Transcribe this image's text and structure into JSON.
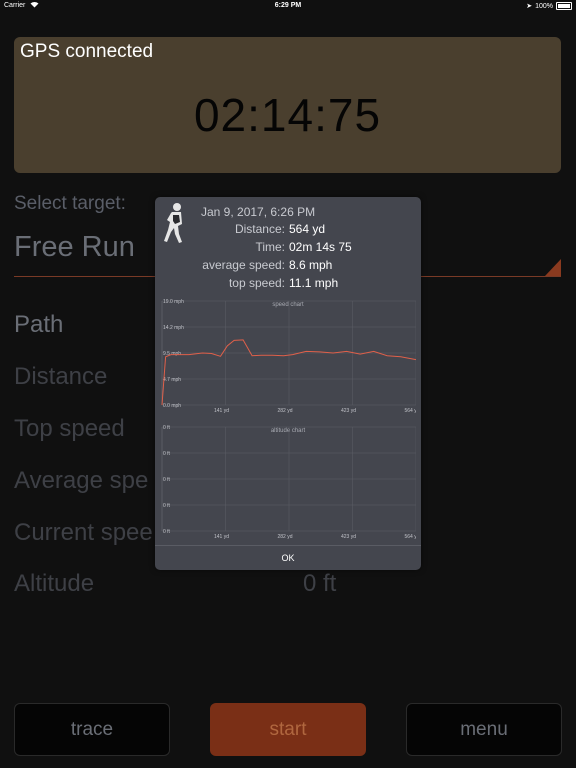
{
  "status_bar": {
    "carrier": "Carrier",
    "time": "6:29 PM",
    "battery": "100%"
  },
  "timer": {
    "gps_status": "GPS connected",
    "elapsed": "02:14:75"
  },
  "target": {
    "label": "Select target:",
    "value": "Free Run"
  },
  "stats": [
    {
      "label": "Path"
    },
    {
      "label": "Distance"
    },
    {
      "label": "Top speed"
    },
    {
      "label": "Average spe"
    },
    {
      "label": "Current spee"
    },
    {
      "label": "Altitude",
      "value": "0 ft"
    }
  ],
  "buttons": {
    "trace": "trace",
    "start": "start",
    "menu": "menu"
  },
  "colors": {
    "accent": "#7a2f16",
    "panel": "#4a3f2e",
    "series": "#e0604a"
  },
  "modal": {
    "date": "Jan 9, 2017, 6:26 PM",
    "rows": [
      {
        "label": "Distance:",
        "value": "564 yd"
      },
      {
        "label": "Time:",
        "value": "02m 14s 75"
      },
      {
        "label": "average speed:",
        "value": "8.6 mph"
      },
      {
        "label": "top speed:",
        "value": "11.1 mph"
      }
    ],
    "ok_label": "OK",
    "runner_icon": "runner-icon"
  },
  "chart_data": [
    {
      "type": "line",
      "title": "speed chart",
      "x_ticks": [
        "141 yd",
        "282 yd",
        "423 yd",
        "564 yd"
      ],
      "y_ticks": [
        "0.0 mph",
        "4.7 mph",
        "9.5 mph",
        "14.2 mph",
        "19.0 mph"
      ],
      "xlim": [
        0,
        564
      ],
      "ylim": [
        0,
        19.0
      ],
      "grid": true,
      "series": [
        {
          "x": [
            0,
            8,
            20,
            60,
            90,
            110,
            130,
            145,
            160,
            180,
            200,
            220,
            245,
            270,
            290,
            320,
            350,
            380,
            410,
            440,
            470,
            500,
            530,
            564
          ],
          "y": [
            0,
            8.8,
            9.2,
            9.2,
            9.5,
            9.4,
            8.9,
            10.8,
            11.8,
            11.9,
            9.0,
            9.1,
            9.1,
            9.0,
            9.2,
            9.8,
            9.7,
            9.5,
            9.8,
            9.3,
            9.8,
            9.0,
            8.8,
            8.3
          ]
        }
      ]
    },
    {
      "type": "line",
      "title": "altitude chart",
      "x_ticks": [
        "141 yd",
        "282 yd",
        "423 yd",
        "564 yd"
      ],
      "y_ticks": [
        "0 ft",
        "0 ft",
        "0 ft",
        "0 ft",
        "0 ft"
      ],
      "xlim": [
        0,
        564
      ],
      "grid": true,
      "series": []
    }
  ]
}
